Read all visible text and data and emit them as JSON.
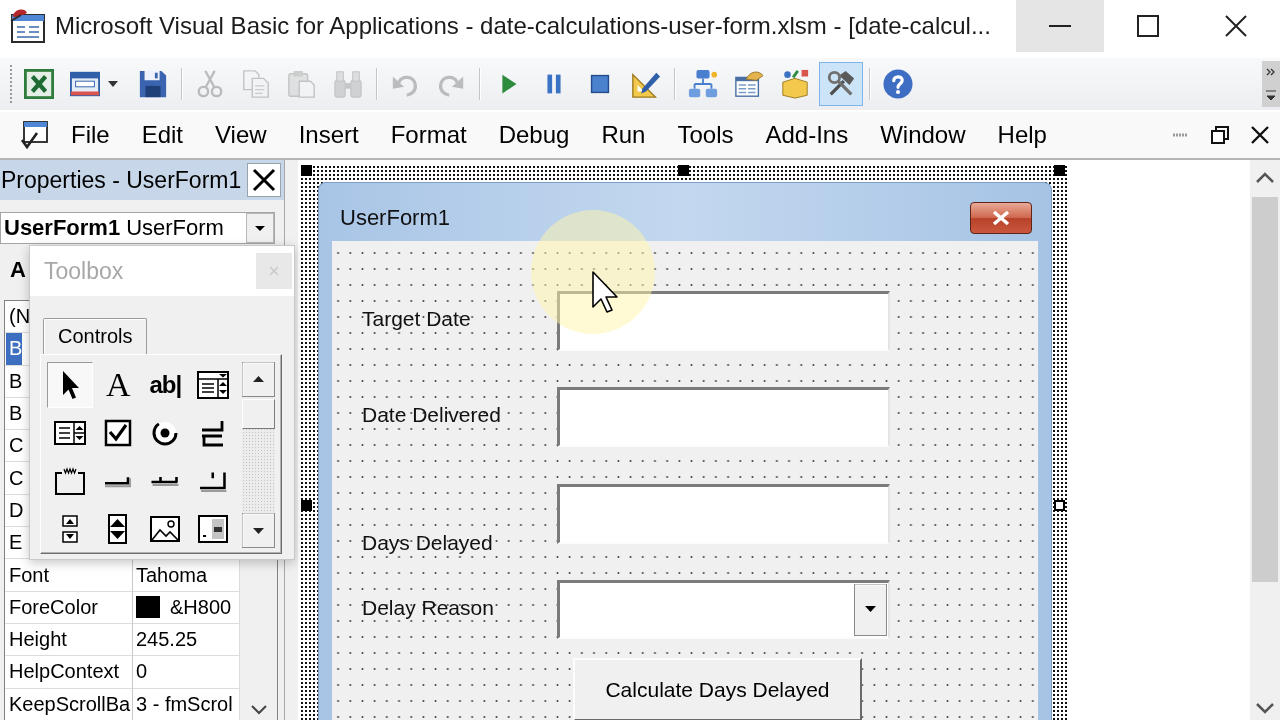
{
  "window": {
    "title": "Microsoft Visual Basic for Applications - date-calculations-user-form.xlsm - [date-calcul...",
    "buttons": [
      {
        "kind": "minimize",
        "hovered": true
      },
      {
        "kind": "maximize",
        "hovered": false
      },
      {
        "kind": "close",
        "hovered": false
      }
    ]
  },
  "toolbar": {
    "groups": [
      {
        "buttons": [
          {
            "kind": "excel",
            "disabled": false,
            "pressed": false
          },
          {
            "kind": "userform",
            "disabled": false,
            "pressed": false
          },
          {
            "kind": "save",
            "disabled": false,
            "pressed": false
          }
        ]
      },
      {
        "buttons": [
          {
            "kind": "cut",
            "disabled": true,
            "pressed": false
          },
          {
            "kind": "copy",
            "disabled": true,
            "pressed": false
          },
          {
            "kind": "paste",
            "disabled": true,
            "pressed": false
          },
          {
            "kind": "find",
            "disabled": true,
            "pressed": false
          }
        ]
      },
      {
        "buttons": [
          {
            "kind": "undo",
            "disabled": true,
            "pressed": false
          },
          {
            "kind": "redo",
            "disabled": true,
            "pressed": false
          }
        ]
      },
      {
        "buttons": [
          {
            "kind": "run",
            "disabled": false,
            "pressed": false
          },
          {
            "kind": "break",
            "disabled": false,
            "pressed": false
          },
          {
            "kind": "reset",
            "disabled": false,
            "pressed": false
          },
          {
            "kind": "design",
            "disabled": false,
            "pressed": false
          }
        ]
      },
      {
        "buttons": [
          {
            "kind": "project",
            "disabled": false,
            "pressed": false
          },
          {
            "kind": "properties",
            "disabled": false,
            "pressed": false
          },
          {
            "kind": "browser",
            "disabled": false,
            "pressed": false
          },
          {
            "kind": "toolbox",
            "disabled": false,
            "pressed": true
          }
        ]
      },
      {
        "buttons": [
          {
            "kind": "help",
            "disabled": false,
            "pressed": false
          }
        ]
      }
    ]
  },
  "menu": {
    "items": [
      {
        "label": "File"
      },
      {
        "label": "Edit"
      },
      {
        "label": "View"
      },
      {
        "label": "Insert"
      },
      {
        "label": "Format"
      },
      {
        "label": "Debug"
      },
      {
        "label": "Run"
      },
      {
        "label": "Tools"
      },
      {
        "label": "Add-Ins"
      },
      {
        "label": "Window"
      },
      {
        "label": "Help"
      }
    ]
  },
  "properties": {
    "title": "Properties - UserForm1",
    "object": {
      "name": "UserForm1",
      "type": "UserForm"
    },
    "tab": "A",
    "rows": [
      {
        "name": "(N",
        "selected": false
      },
      {
        "name": "B",
        "selected": true
      },
      {
        "name": "B",
        "selected": false
      },
      {
        "name": "B",
        "selected": false
      },
      {
        "name": "C",
        "selected": false
      },
      {
        "name": "C",
        "selected": false
      },
      {
        "name": "D",
        "selected": false
      },
      {
        "name": "E",
        "selected": false
      },
      {
        "name": "Font",
        "value": "Tahoma",
        "selected": false
      },
      {
        "name": "ForeColor",
        "value": "&H800",
        "color": "#000000",
        "selected": false
      },
      {
        "name": "Height",
        "value": "245.25",
        "selected": false
      },
      {
        "name": "HelpContext",
        "value": "0",
        "selected": false
      },
      {
        "name": "KeepScrollBa",
        "value": "3 - fmScrol",
        "selected": false
      }
    ]
  },
  "toolbox": {
    "title": "Toolbox",
    "active": false,
    "tab": "Controls",
    "tools": [
      {
        "kind": "pointer",
        "selected": true
      },
      {
        "kind": "label",
        "glyph": "A",
        "selected": false
      },
      {
        "kind": "textbox",
        "glyph": "ab|",
        "selected": false
      },
      {
        "kind": "combobox",
        "selected": false
      },
      {
        "kind": "listbox",
        "selected": false
      },
      {
        "kind": "checkbox",
        "selected": false
      },
      {
        "kind": "optionbutton",
        "selected": false
      },
      {
        "kind": "togglebutton",
        "selected": false
      },
      {
        "kind": "frame",
        "selected": false
      },
      {
        "kind": "commandbutton",
        "selected": false
      },
      {
        "kind": "tabstrip",
        "selected": false
      },
      {
        "kind": "multipage",
        "selected": false
      },
      {
        "kind": "scrollbar",
        "selected": false
      },
      {
        "kind": "spinbutton",
        "selected": false
      },
      {
        "kind": "image",
        "selected": false
      },
      {
        "kind": "refedit",
        "selected": false
      }
    ]
  },
  "form": {
    "caption": "UserForm1",
    "selected": true,
    "controls": [
      {
        "kind": "label",
        "text": "Target Date"
      },
      {
        "kind": "textbox"
      },
      {
        "kind": "label",
        "text": "Date Delivered"
      },
      {
        "kind": "textbox"
      },
      {
        "kind": "textbox"
      },
      {
        "kind": "label",
        "text": "Days Delayed"
      },
      {
        "kind": "label",
        "text": "Delay Reason"
      },
      {
        "kind": "combobox"
      },
      {
        "kind": "commandbutton",
        "text": "Calculate Days Delayed"
      }
    ]
  }
}
